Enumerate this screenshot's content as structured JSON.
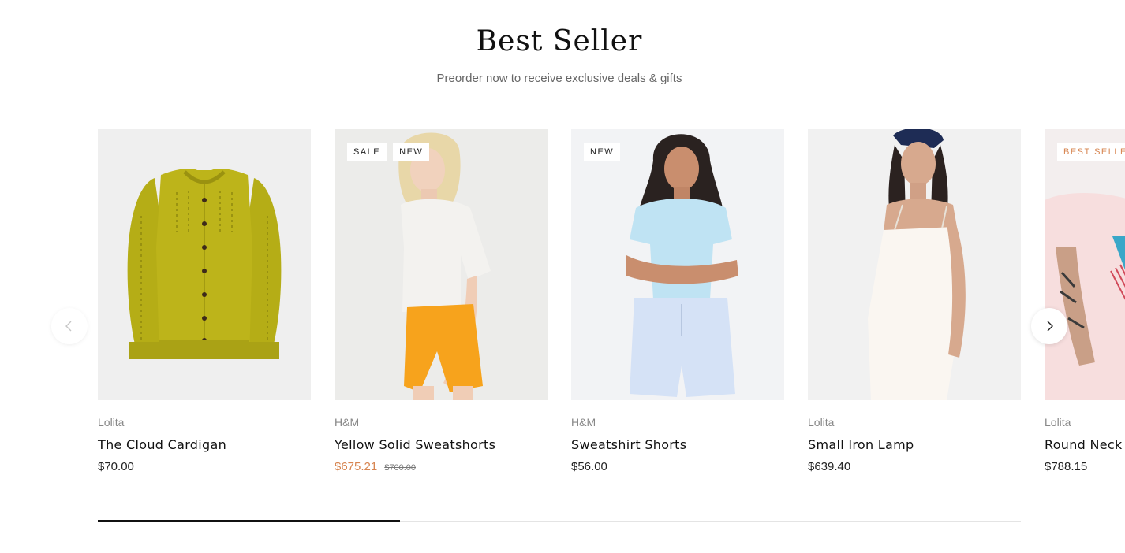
{
  "section": {
    "title": "Best Seller",
    "subtitle": "Preorder now to receive exclusive deals & gifts"
  },
  "products": [
    {
      "brand": "Lolita",
      "name": "The Cloud Cardigan",
      "price": "$70.00",
      "old_price": "",
      "badges": [],
      "image": "yellow-cardigan-image"
    },
    {
      "brand": "H&M",
      "name": "Yellow Solid Sweatshorts",
      "price": "$675.21",
      "old_price": "$700.00",
      "badges": [
        "SALE",
        "NEW"
      ],
      "image": "model-white-tee-orange-shorts-image"
    },
    {
      "brand": "H&M",
      "name": "Sweatshirt Shorts",
      "price": "$56.00",
      "old_price": "",
      "badges": [
        "NEW"
      ],
      "image": "model-blue-tee-blue-shorts-image"
    },
    {
      "brand": "Lolita",
      "name": "Small Iron Lamp",
      "price": "$639.40",
      "old_price": "",
      "badges": [],
      "image": "model-white-satin-dress-image"
    },
    {
      "brand": "Lolita",
      "name": "Round Neck",
      "price": "$788.15",
      "old_price": "",
      "badges": [
        "BEST SELLER"
      ],
      "image": "model-pink-graphic-tee-image"
    }
  ],
  "carousel": {
    "prev_icon": "chevron-left-icon",
    "next_icon": "chevron-right-icon",
    "progress_fraction": 0.327
  },
  "colors": {
    "sale_price": "#d7844f",
    "best_seller_badge": "#d7844f",
    "progress_fill": "#111111",
    "progress_track": "#e4e4e4"
  }
}
